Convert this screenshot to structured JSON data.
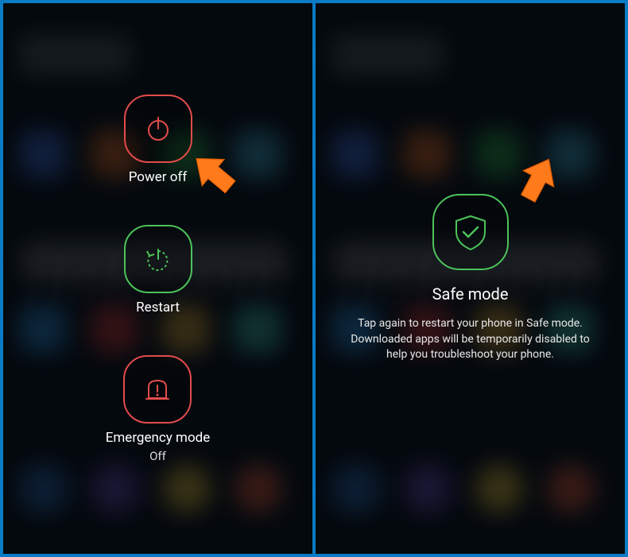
{
  "left": {
    "options": [
      {
        "label": "Power off",
        "icon": "power-icon",
        "color": "red"
      },
      {
        "label": "Restart",
        "icon": "restart-icon",
        "color": "green"
      },
      {
        "label": "Emergency mode",
        "sub": "Off",
        "icon": "emergency-icon",
        "color": "red"
      }
    ]
  },
  "right": {
    "title": "Safe mode",
    "description": "Tap again to restart your phone in Safe mode. Downloaded apps will be temporarily disabled to help you troubleshoot your phone.",
    "icon": "shield-check-icon"
  },
  "colors": {
    "red": "#e24b4b",
    "green": "#4cc25a",
    "arrow": "#ff7a1a"
  }
}
